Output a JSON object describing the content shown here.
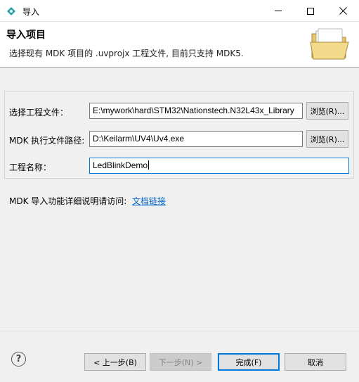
{
  "window": {
    "title": "导入",
    "icon": "eclipse-app-icon",
    "minimize_icon": "minimize-icon",
    "maximize_icon": "maximize-icon",
    "close_icon": "close-icon"
  },
  "banner": {
    "title": "导入项目",
    "description": "选择现有 MDK 项目的 .uvprojx 工程文件, 目前只支持 MDK5.",
    "icon": "open-folder-icon"
  },
  "form": {
    "project_file": {
      "label": "选择工程文件：",
      "value": "E:\\mywork\\hard\\STM32\\Nationstech.N32L43x_Library",
      "browse_label": "浏览(R)..."
    },
    "mdk_path": {
      "label": "MDK 执行文件路径:",
      "value": "D:\\Keilarm\\UV4\\Uv4.exe",
      "browse_label": "浏览(R)..."
    },
    "project_name": {
      "label": "工程名称：",
      "value": "LedBlinkDemo"
    }
  },
  "help": {
    "text": "MDK 导入功能详细说明请访问:",
    "link_label": "文档链接"
  },
  "footer": {
    "help_icon": "help-icon",
    "help_glyph": "?",
    "back_label": "< 上一步(B)",
    "next_label": "下一步(N) >",
    "finish_label": "完成(F)",
    "cancel_label": "取消"
  },
  "colors": {
    "accent": "#0078d7",
    "link": "#0066cc"
  }
}
